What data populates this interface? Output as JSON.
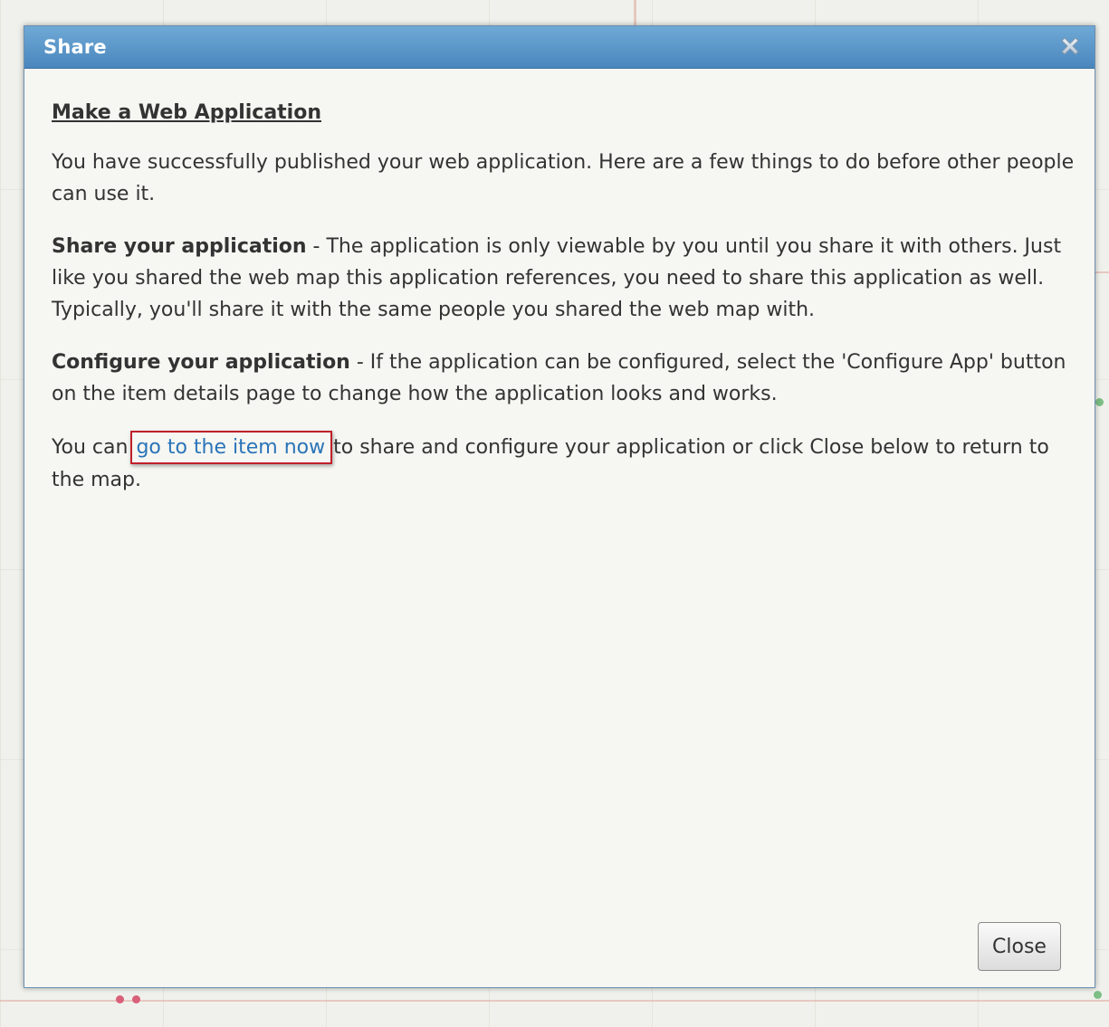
{
  "dialog": {
    "title": "Share",
    "close_icon": "close-x-icon",
    "heading": "Make a Web Application",
    "intro": "You have successfully published your web application. Here are a few things to do before other people can use it.",
    "share_section": {
      "label": "Share your application",
      "text": " - The application is only viewable by you until you share it with others. Just like you shared the web map this application references, you need to share this application as well. Typically, you'll share it with the same people you shared the web map with."
    },
    "configure_section": {
      "label": "Configure your application",
      "text": " - If the application can be configured, select the 'Configure App' button on the item details page to change how the application looks and works."
    },
    "final_paragraph": {
      "before_link": "You can ",
      "link_text": "go to the item now",
      "after_link": " to share and configure your application or click Close below to return to the map."
    },
    "close_button_label": "Close"
  },
  "colors": {
    "titlebar": "#4a86bd",
    "link": "#2a74b8",
    "highlight_box": "#c0202a"
  }
}
